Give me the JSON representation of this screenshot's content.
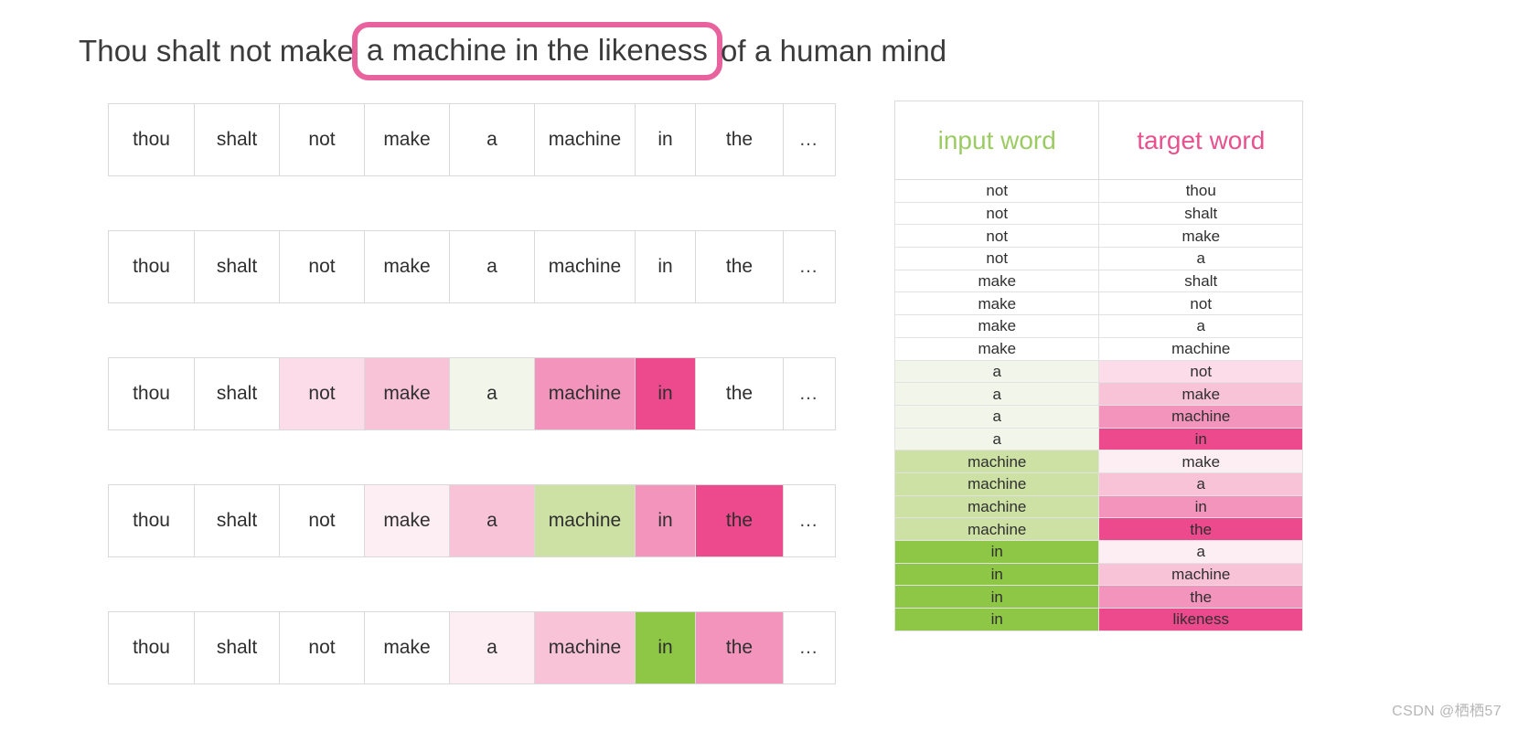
{
  "title": {
    "prefix": "Thou shalt not make",
    "highlighted": "a machine in the likeness",
    "suffix": "of a human mind",
    "highlight_border_color": "#e8639d"
  },
  "palette": {
    "white": "#ffffff",
    "pink_1": "#fdeef4",
    "pink_2": "#fbdce8",
    "pink_3": "#f8c3d7",
    "pink_4": "#f294bb",
    "pink_5": "#ec4a8c",
    "green_0": "#f2f6ea",
    "green_1": "#cde1a5",
    "green_2": "#8ec645",
    "header_green": "#9ccb63",
    "header_pink": "#e8518e"
  },
  "sentence_grid": {
    "words": [
      "thou",
      "shalt",
      "not",
      "make",
      "a",
      "machine",
      "in",
      "the",
      "…"
    ],
    "rows": [
      {
        "label": "row-1",
        "cells": [
          {
            "word": "thou",
            "bg": "#ffffff"
          },
          {
            "word": "shalt",
            "bg": "#ffffff"
          },
          {
            "word": "not",
            "bg": "#ffffff"
          },
          {
            "word": "make",
            "bg": "#ffffff"
          },
          {
            "word": "a",
            "bg": "#ffffff"
          },
          {
            "word": "machine",
            "bg": "#ffffff"
          },
          {
            "word": "in",
            "bg": "#ffffff"
          },
          {
            "word": "the",
            "bg": "#ffffff"
          },
          {
            "word": "…",
            "bg": "#ffffff"
          }
        ]
      },
      {
        "label": "row-2",
        "cells": [
          {
            "word": "thou",
            "bg": "#ffffff"
          },
          {
            "word": "shalt",
            "bg": "#ffffff"
          },
          {
            "word": "not",
            "bg": "#ffffff"
          },
          {
            "word": "make",
            "bg": "#ffffff"
          },
          {
            "word": "a",
            "bg": "#ffffff"
          },
          {
            "word": "machine",
            "bg": "#ffffff"
          },
          {
            "word": "in",
            "bg": "#ffffff"
          },
          {
            "word": "the",
            "bg": "#ffffff"
          },
          {
            "word": "…",
            "bg": "#ffffff"
          }
        ]
      },
      {
        "label": "row-3",
        "cells": [
          {
            "word": "thou",
            "bg": "#ffffff"
          },
          {
            "word": "shalt",
            "bg": "#ffffff"
          },
          {
            "word": "not",
            "bg": "#fbdce8"
          },
          {
            "word": "make",
            "bg": "#f8c3d7"
          },
          {
            "word": "a",
            "bg": "#f2f6ea"
          },
          {
            "word": "machine",
            "bg": "#f294bb"
          },
          {
            "word": "in",
            "bg": "#ec4a8c"
          },
          {
            "word": "the",
            "bg": "#ffffff"
          },
          {
            "word": "…",
            "bg": "#ffffff"
          }
        ]
      },
      {
        "label": "row-4",
        "cells": [
          {
            "word": "thou",
            "bg": "#ffffff"
          },
          {
            "word": "shalt",
            "bg": "#ffffff"
          },
          {
            "word": "not",
            "bg": "#ffffff"
          },
          {
            "word": "make",
            "bg": "#fdeef4"
          },
          {
            "word": "a",
            "bg": "#f8c3d7"
          },
          {
            "word": "machine",
            "bg": "#cde1a5"
          },
          {
            "word": "in",
            "bg": "#f294bb"
          },
          {
            "word": "the",
            "bg": "#ec4a8c"
          },
          {
            "word": "…",
            "bg": "#ffffff"
          }
        ]
      },
      {
        "label": "row-5",
        "cells": [
          {
            "word": "thou",
            "bg": "#ffffff"
          },
          {
            "word": "shalt",
            "bg": "#ffffff"
          },
          {
            "word": "not",
            "bg": "#ffffff"
          },
          {
            "word": "make",
            "bg": "#ffffff"
          },
          {
            "word": "a",
            "bg": "#fdeef4"
          },
          {
            "word": "machine",
            "bg": "#f8c3d7"
          },
          {
            "word": "in",
            "bg": "#8ec645"
          },
          {
            "word": "the",
            "bg": "#f294bb"
          },
          {
            "word": "…",
            "bg": "#ffffff"
          }
        ]
      }
    ]
  },
  "pair_table": {
    "headers": {
      "input": "input word",
      "target": "target word"
    },
    "rows": [
      {
        "input": "not",
        "target": "thou",
        "input_bg": "#ffffff",
        "target_bg": "#ffffff"
      },
      {
        "input": "not",
        "target": "shalt",
        "input_bg": "#ffffff",
        "target_bg": "#ffffff"
      },
      {
        "input": "not",
        "target": "make",
        "input_bg": "#ffffff",
        "target_bg": "#ffffff"
      },
      {
        "input": "not",
        "target": "a",
        "input_bg": "#ffffff",
        "target_bg": "#ffffff"
      },
      {
        "input": "make",
        "target": "shalt",
        "input_bg": "#ffffff",
        "target_bg": "#ffffff"
      },
      {
        "input": "make",
        "target": "not",
        "input_bg": "#ffffff",
        "target_bg": "#ffffff"
      },
      {
        "input": "make",
        "target": "a",
        "input_bg": "#ffffff",
        "target_bg": "#ffffff"
      },
      {
        "input": "make",
        "target": "machine",
        "input_bg": "#ffffff",
        "target_bg": "#ffffff"
      },
      {
        "input": "a",
        "target": "not",
        "input_bg": "#f2f6ea",
        "target_bg": "#fbdce8"
      },
      {
        "input": "a",
        "target": "make",
        "input_bg": "#f2f6ea",
        "target_bg": "#f8c3d7"
      },
      {
        "input": "a",
        "target": "machine",
        "input_bg": "#f2f6ea",
        "target_bg": "#f294bb"
      },
      {
        "input": "a",
        "target": "in",
        "input_bg": "#f2f6ea",
        "target_bg": "#ec4a8c"
      },
      {
        "input": "machine",
        "target": "make",
        "input_bg": "#cde1a5",
        "target_bg": "#fdeef4"
      },
      {
        "input": "machine",
        "target": "a",
        "input_bg": "#cde1a5",
        "target_bg": "#f8c3d7"
      },
      {
        "input": "machine",
        "target": "in",
        "input_bg": "#cde1a5",
        "target_bg": "#f294bb"
      },
      {
        "input": "machine",
        "target": "the",
        "input_bg": "#cde1a5",
        "target_bg": "#ec4a8c"
      },
      {
        "input": "in",
        "target": "a",
        "input_bg": "#8ec645",
        "target_bg": "#fdeef4"
      },
      {
        "input": "in",
        "target": "machine",
        "input_bg": "#8ec645",
        "target_bg": "#f8c3d7"
      },
      {
        "input": "in",
        "target": "the",
        "input_bg": "#8ec645",
        "target_bg": "#f294bb"
      },
      {
        "input": "in",
        "target": "likeness",
        "input_bg": "#8ec645",
        "target_bg": "#ec4a8c"
      }
    ]
  },
  "watermark": {
    "text": "CSDN @栖栖57"
  }
}
